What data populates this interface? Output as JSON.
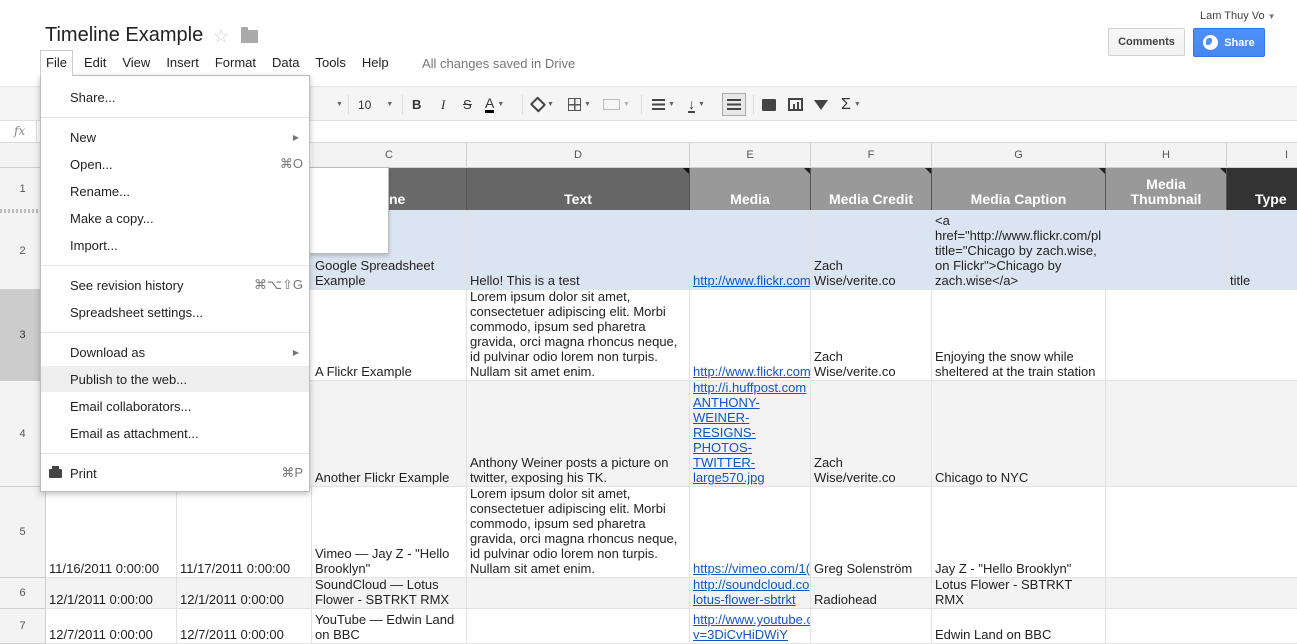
{
  "doc": {
    "title": "Timeline Example",
    "user": "Lam Thuy Vo",
    "saved_status": "All changes saved in Drive"
  },
  "header": {
    "comments_label": "Comments",
    "share_label": "Share"
  },
  "menubar": [
    "File",
    "Edit",
    "View",
    "Insert",
    "Format",
    "Data",
    "Tools",
    "Help"
  ],
  "toolbar": {
    "font_size": "10",
    "bold": "B",
    "italic": "I",
    "strike": "S",
    "text_color": "A",
    "sigma": "Σ"
  },
  "formula_bar": {
    "fx_label": "fx",
    "value": ""
  },
  "columns": [
    "C",
    "D",
    "E",
    "F",
    "G",
    "H",
    "I"
  ],
  "rows": [
    "1",
    "2",
    "3",
    "4",
    "5",
    "6",
    "7"
  ],
  "header_row": {
    "c": "Headline",
    "c_visible": "dline",
    "d": "Text",
    "e": "Media",
    "f": "Media Credit",
    "g": "Media Caption",
    "h": "Media\nThumbnail",
    "i": "Type"
  },
  "data_rows": [
    {
      "a": "",
      "b": "",
      "c": "Google Spreadsheet\nExample",
      "d": "Hello! This is a test",
      "e": "http://www.flickr.com",
      "f": "Zach\nWise/verite.co",
      "g": "<a\nhref=\"http://www.flickr.com/pl\ntitle=\"Chicago by zach.wise,\non Flickr\">Chicago by\nzach.wise</a>",
      "i": "title"
    },
    {
      "a": "",
      "b": "",
      "c": "A Flickr Example",
      "d": "Lorem ipsum dolor sit amet,\nconsectetuer adipiscing elit. Morbi\ncommodo, ipsum sed pharetra\ngravida, orci magna rhoncus neque,\nid pulvinar odio lorem non turpis.\nNullam sit amet enim.",
      "e": "http://www.flickr.com",
      "f": "Zach\nWise/verite.co",
      "g": "Enjoying the snow while\nsheltered at the train station",
      "i": ""
    },
    {
      "a": "",
      "b": "",
      "c": "Another Flickr Example",
      "d": "Anthony Weiner posts a picture on\ntwitter, exposing his TK.",
      "e": "http://i.huffpost.com\nANTHONY-\nWEINER-\nRESIGNS-\nPHOTOS-\nTWITTER-\nlarge570.jpg",
      "f": "Zach\nWise/verite.co",
      "g": "Chicago to NYC",
      "i": ""
    },
    {
      "a": "11/16/2011 0:00:00",
      "b": "11/17/2011 0:00:00",
      "c": "Vimeo — Jay Z - \"Hello\nBrooklyn\"",
      "d": "Lorem ipsum dolor sit amet,\nconsectetuer adipiscing elit. Morbi\ncommodo, ipsum sed pharetra\ngravida, orci magna rhoncus neque,\nid pulvinar odio lorem non turpis.\nNullam sit amet enim.",
      "e": "https://vimeo.com/1(",
      "f": "Greg Solenström",
      "g": "Jay Z - \"Hello Brooklyn\"",
      "i": ""
    },
    {
      "a": "12/1/2011 0:00:00",
      "b": "12/1/2011 0:00:00",
      "c": "SoundCloud — Lotus\nFlower - SBTRKT RMX",
      "d": "",
      "e": "http://soundcloud.co\nlotus-flower-sbtrkt",
      "f": "Radiohead",
      "g": "Lotus Flower - SBTRKT\nRMX",
      "i": ""
    },
    {
      "a": "12/7/2011 0:00:00",
      "b": "12/7/2011 0:00:00",
      "c": "YouTube — Edwin Land\non BBC",
      "d": "",
      "e": "http://www.youtube.c\nv=3DiCvHiDWiY",
      "f": "",
      "g": "Edwin Land on BBC",
      "i": ""
    }
  ],
  "file_menu": {
    "share": "Share...",
    "new": "New",
    "open": "Open...",
    "open_sc": "⌘O",
    "rename": "Rename...",
    "make_copy": "Make a copy...",
    "import": "Import...",
    "revision": "See revision history",
    "revision_sc": "⌘⌥⇧G",
    "settings": "Spreadsheet settings...",
    "download": "Download as",
    "publish": "Publish to the web...",
    "email_collab": "Email collaborators...",
    "email_attach": "Email as attachment...",
    "print": "Print",
    "print_sc": "⌘P"
  }
}
